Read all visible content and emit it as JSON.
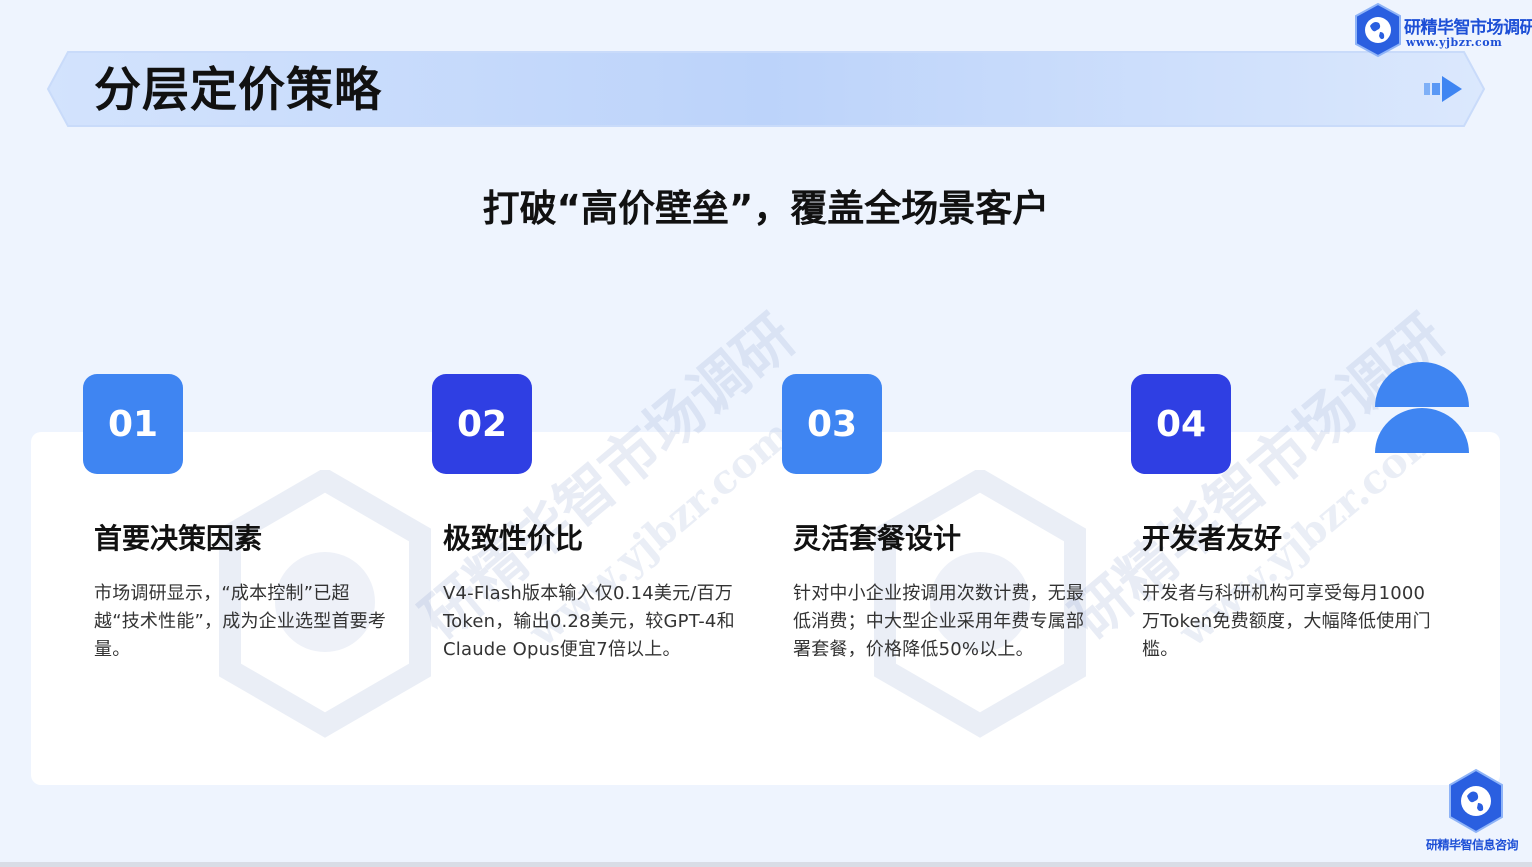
{
  "slide": {
    "title": "分层定价策略",
    "subtitle": "打破“高价壁垒”，覆盖全场景客户"
  },
  "logo": {
    "name": "研精毕智市场调研",
    "url": "www.yjbzr.com",
    "bottom_name": "研精毕智信息咨询"
  },
  "watermark": {
    "text": "研精毕智市场调研",
    "url": "www.yjbzr.com"
  },
  "items": [
    {
      "number": "01",
      "title": "首要决策因素",
      "desc": "市场调研显示，“成本控制”已超越“技术性能”，成为企业选型首要考量。"
    },
    {
      "number": "02",
      "title": "极致性价比",
      "desc": "V4-Flash版本输入仅0.14美元/百万Token，输出0.28美元，较GPT-4和Claude Opus便宜7倍以上。"
    },
    {
      "number": "03",
      "title": "灵活套餐设计",
      "desc": "针对中小企业按调用次数计费，无最低消费；中大型企业采用年费专属部署套餐，价格降低50%以上。"
    },
    {
      "number": "04",
      "title": "开发者友好",
      "desc": "开发者与科研机构可享受每月1000万Token免费额度，大幅降低使用门槛。"
    }
  ],
  "colors": {
    "background": "#eef4fe",
    "number_box_light": "#3f85f2",
    "number_box_dark": "#2f3fe3",
    "banner_gradient_start": "#dbe8fd",
    "banner_gradient_end": "#b7d0fa"
  }
}
